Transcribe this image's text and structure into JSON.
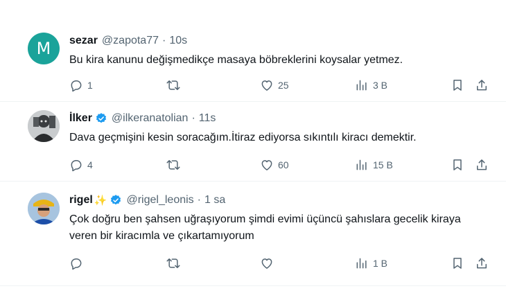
{
  "replies": [
    {
      "name": "sezar",
      "handle": "@zapota77",
      "separator": "·",
      "time": "10s",
      "avatar_letter": "M",
      "avatar_color": "#1aa39a",
      "verified": false,
      "text": "Bu kira kanunu değişmedikçe masaya böbreklerini koysalar yetmez.",
      "replies_count": "1",
      "retweets_count": "",
      "likes_count": "25",
      "views_count": "3 B"
    },
    {
      "name": "İlker",
      "handle": "@ilkeranatolian",
      "separator": "·",
      "time": "11s",
      "verified": true,
      "text": "Dava geçmişini kesin soracağım.İtiraz ediyorsa sıkıntılı kiracı demektir.",
      "replies_count": "4",
      "retweets_count": "",
      "likes_count": "60",
      "views_count": "15 B"
    },
    {
      "name": "rigel",
      "sparkle": "✨",
      "handle": "@rigel_leonis",
      "separator": "·",
      "time": "1 sa",
      "verified": true,
      "text": "Çok doğru ben şahsen uğraşıyorum şimdi evimi üçüncü şahıslara gecelik kiraya veren bir kiracımla ve çıkartamıyorum",
      "replies_count": "",
      "retweets_count": "",
      "likes_count": "",
      "views_count": "1 B"
    }
  ],
  "colors": {
    "verified_blue": "#1d9bf0",
    "muted_text": "#536471",
    "divider": "#eff3f4"
  },
  "icons": [
    "reply-icon",
    "retweet-icon",
    "like-icon",
    "views-icon",
    "bookmark-icon",
    "share-icon",
    "verified-icon"
  ]
}
